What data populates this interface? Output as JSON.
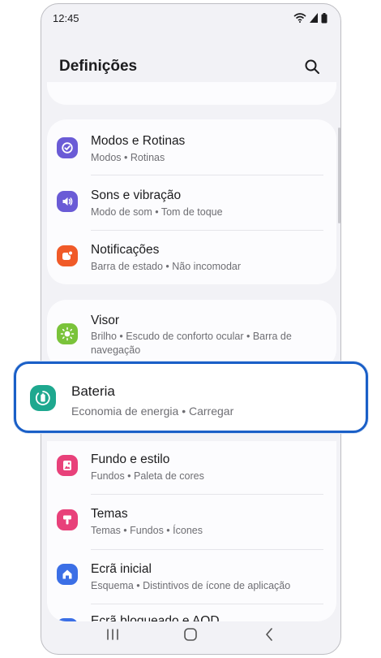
{
  "status_bar": {
    "time": "12:45"
  },
  "header": {
    "title": "Definições"
  },
  "group_a": [
    {
      "title": "Modos e Rotinas",
      "subtitle": "Modos  •  Rotinas",
      "icon": "routine-check-icon",
      "color": "#6a5bd6"
    },
    {
      "title": "Sons e vibração",
      "subtitle": "Modo de som  •  Tom de toque",
      "icon": "speaker-icon",
      "color": "#6a5bd6"
    },
    {
      "title": "Notificações",
      "subtitle": "Barra de estado  •  Não incomodar",
      "icon": "notification-icon",
      "color": "#f05a28"
    }
  ],
  "group_b": [
    {
      "title": "Visor",
      "subtitle": "Brilho  •  Escudo de conforto ocular  •  Barra de navegação",
      "icon": "sun-icon",
      "color": "#7ac33a"
    }
  ],
  "highlighted": {
    "title": "Bateria",
    "subtitle": "Economia de energia  •  Carregar",
    "icon": "battery-icon",
    "color": "#1ea88f",
    "outline_color": "#1a5fc7"
  },
  "group_c": [
    {
      "title": "Fundo e estilo",
      "subtitle": "Fundos  •  Paleta de cores",
      "icon": "wallpaper-icon",
      "color": "#e8417a"
    },
    {
      "title": "Temas",
      "subtitle": "Temas  •  Fundos  •  Ícones",
      "icon": "theme-brush-icon",
      "color": "#e8417a"
    },
    {
      "title": "Ecrã inicial",
      "subtitle": "Esquema  •  Distintivos de ícone de aplicação",
      "icon": "home-icon",
      "color": "#3b6fe6"
    },
    {
      "title": "Ecrã bloqueado e AOD",
      "icon": "lock-screen-icon",
      "color": "#3b6fe6"
    }
  ]
}
